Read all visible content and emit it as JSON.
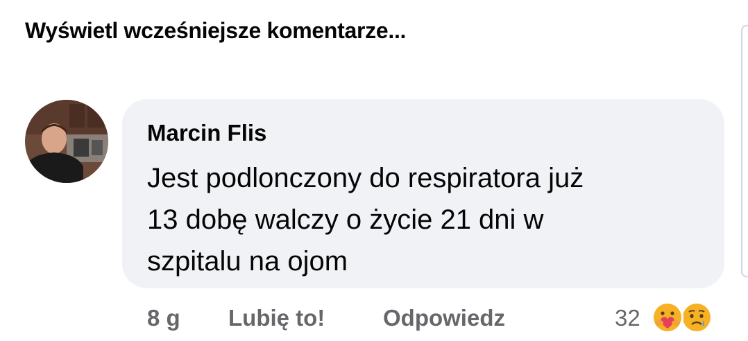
{
  "header": {
    "prev_comments_label": "Wyświetl wcześniejsze komentarze..."
  },
  "comment": {
    "author": "Marcin Flis",
    "text_lines": [
      "Jest podlonczony do respiratora już",
      "13 dobę walczy o życie 21 dni w",
      "szpitalu na ojom"
    ],
    "time": "8 g",
    "like_label": "Lubię to!",
    "reply_label": "Odpowiedz",
    "reaction_count": "32",
    "reaction_icons": [
      "care-reaction-icon",
      "sad-reaction-icon"
    ]
  },
  "colors": {
    "bubble_bg": "#f0f2f5",
    "secondary_text": "#65676b",
    "primary_text": "#050505",
    "reaction_yellow": "#f7b125"
  }
}
